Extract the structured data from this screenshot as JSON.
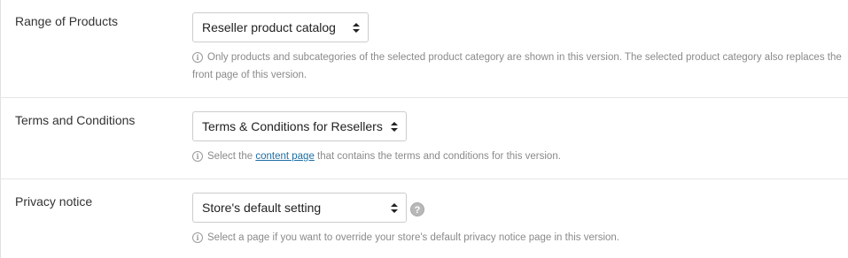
{
  "rows": [
    {
      "label": "Range of Products",
      "select_value": "Reseller product catalog",
      "help_text": "Only products and subcategories of the selected product category are shown in this version. The selected product category also replaces the front page of this version."
    },
    {
      "label": "Terms and Conditions",
      "select_value": "Terms & Conditions for Resellers",
      "help_prefix": "Select the ",
      "help_link": "content page",
      "help_suffix": " that contains the terms and conditions for this version."
    },
    {
      "label": "Privacy notice",
      "select_value": "Store's default setting",
      "help_text": "Select a page if you want to override your store's default privacy notice page in this version.",
      "help_icon": "question-mark-icon"
    }
  ],
  "icons": {
    "info": "info-icon",
    "dropdown": "updown-arrows-icon"
  },
  "colors": {
    "link": "#1d6fa5",
    "help_text": "#8a8a8a",
    "border": "#cccccc"
  }
}
